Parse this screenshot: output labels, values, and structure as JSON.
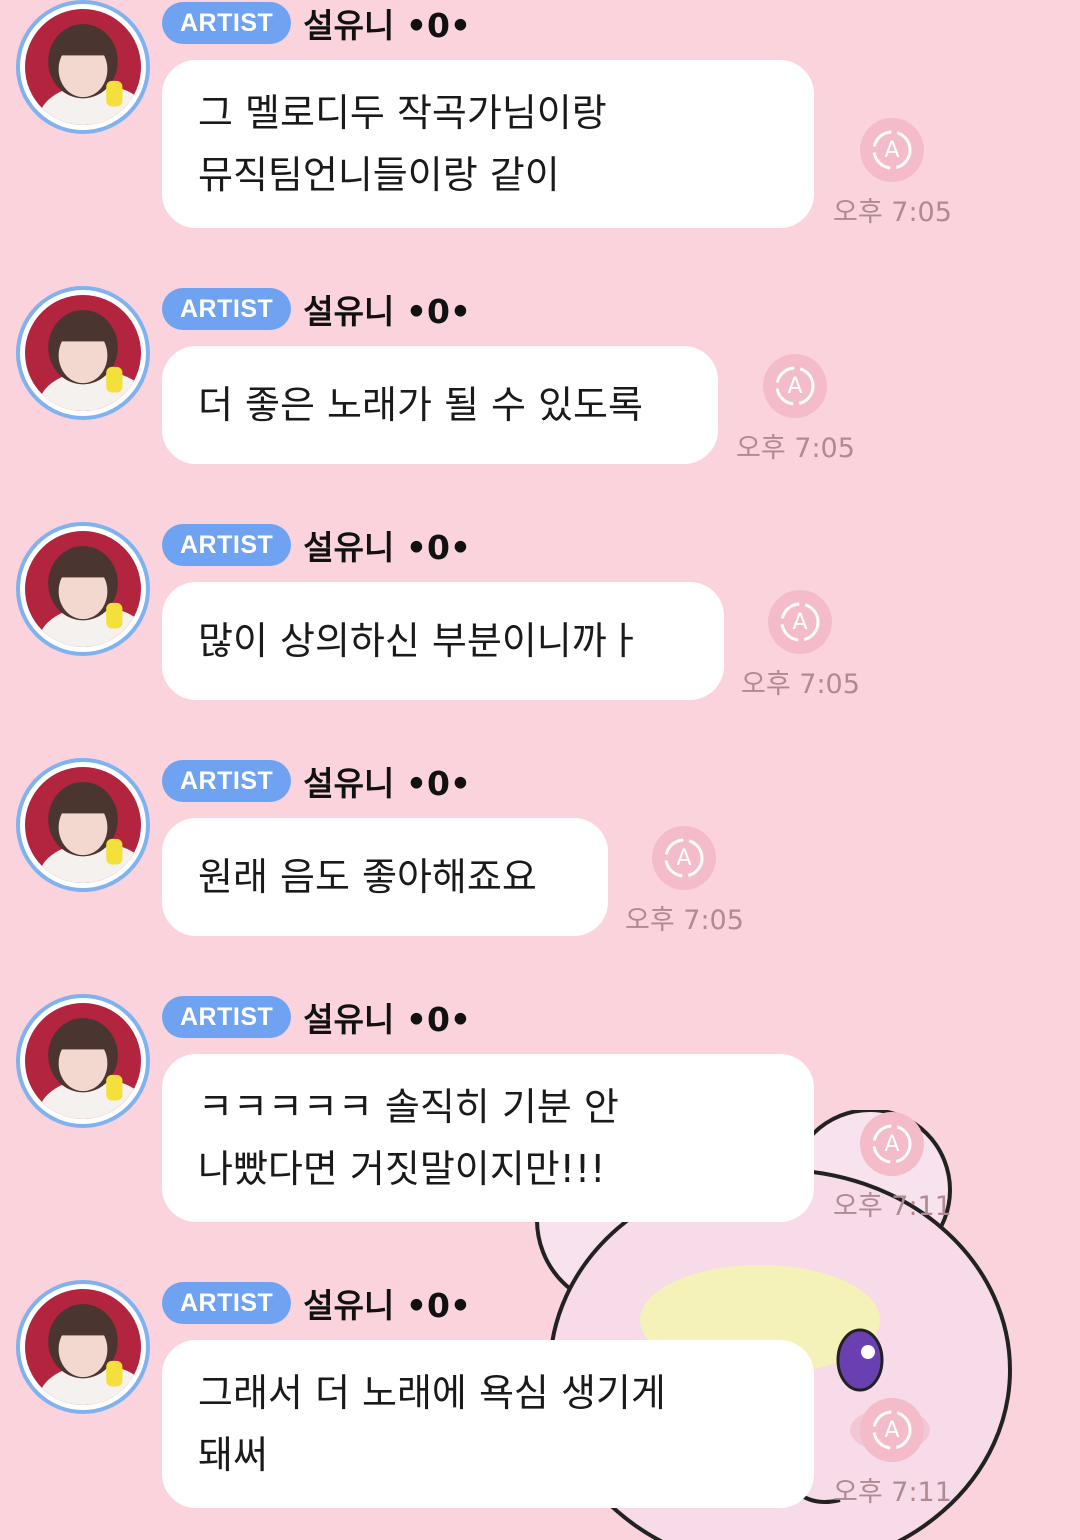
{
  "colors": {
    "background": "#fbd3dc",
    "badge": "#6fa3f2",
    "bubble": "#ffffff",
    "avatar_ring": "#7fb2ee",
    "time": "#b08a93"
  },
  "icons": {
    "translate": "translate-a-icon",
    "avatar": "avatar-photo"
  },
  "messages": [
    {
      "badge": "ARTIST",
      "sender": "설유니 •0•",
      "lines": [
        "그 멜로디두 작곡가님이랑",
        "뮤직팀언니들이랑 같이"
      ],
      "time": "오후 7:05"
    },
    {
      "badge": "ARTIST",
      "sender": "설유니 •0•",
      "lines": [
        "더 좋은 노래가 될 수 있도록"
      ],
      "time": "오후 7:05"
    },
    {
      "badge": "ARTIST",
      "sender": "설유니 •0•",
      "lines": [
        "많이 상의하신 부분이니까ㅏ"
      ],
      "time": "오후 7:05"
    },
    {
      "badge": "ARTIST",
      "sender": "설유니 •0•",
      "lines": [
        "원래 음도 좋아해죠요"
      ],
      "time": "오후 7:05"
    },
    {
      "badge": "ARTIST",
      "sender": "설유니 •0•",
      "lines": [
        "ㅋㅋㅋㅋㅋ 솔직히 기분 안",
        "나빴다면 거짓말이지만!!!"
      ],
      "time": "오후 7:11"
    },
    {
      "badge": "ARTIST",
      "sender": "설유니 •0•",
      "lines": [
        "그래서 더 노래에 욕심 생기게",
        "돼써"
      ],
      "time": "오후 7:11"
    }
  ]
}
